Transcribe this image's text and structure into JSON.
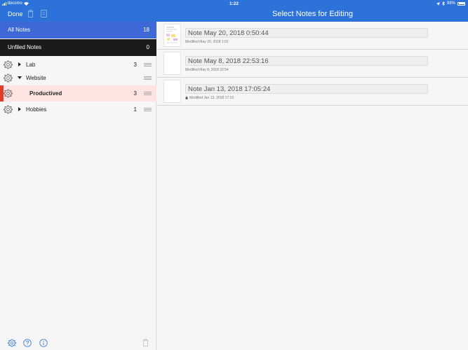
{
  "status_bar": {
    "carrier": "docomo",
    "time": "1:22",
    "battery": "98%"
  },
  "nav": {
    "done_label": "Done",
    "title": "Select Notes for Editing"
  },
  "sidebar": {
    "all_notes": {
      "label": "All Notes",
      "count": "18"
    },
    "unfiled": {
      "label": "Unfiled Notes",
      "count": "0"
    },
    "folders": [
      {
        "label": "Lab",
        "count": "3"
      },
      {
        "label": "Website",
        "count": ""
      },
      {
        "label": "Productived",
        "count": "3"
      },
      {
        "label": "Hobbies",
        "count": "1"
      }
    ]
  },
  "notes": [
    {
      "title": "Note May 20, 2018 0:50:44",
      "modified": "Modified May 20, 2018 1:01"
    },
    {
      "title": "Note May 8, 2018 22:53:16",
      "modified": "Modified May 8, 2018 22:54"
    },
    {
      "title": "Note Jan 13, 2018 17:05:24",
      "modified": "Modified Jan 13, 2018 17:10"
    }
  ],
  "colors": {
    "accent": "#2d72d9",
    "all_notes_bg": "#3e68d6",
    "unfiled_bg": "#1b1b1b",
    "selected_marker": "#e03a2a",
    "selected_bg": "#fde4e1"
  }
}
